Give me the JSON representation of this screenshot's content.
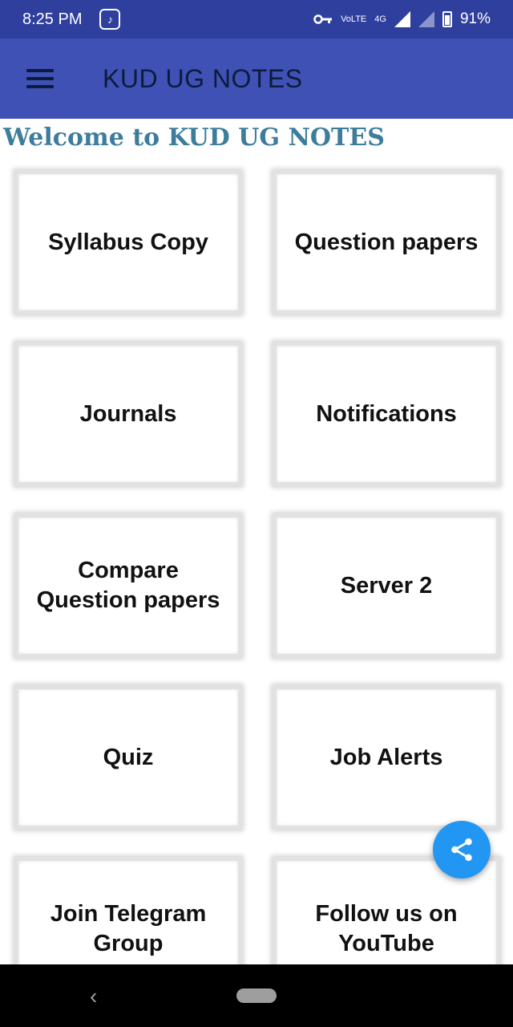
{
  "status_bar": {
    "time": "8:25 PM",
    "app_icon": "saavn-icon",
    "network": "4G",
    "volte": "VoLTE",
    "battery_level": "91%"
  },
  "app_bar": {
    "menu_icon": "hamburger-menu-icon",
    "title": "KUD UG NOTES"
  },
  "welcome": "Welcome to KUD UG NOTES",
  "cards": [
    {
      "label": "Syllabus Copy"
    },
    {
      "label": "Question papers"
    },
    {
      "label": "Journals"
    },
    {
      "label": "Notifications"
    },
    {
      "label": "Compare\nQuestion papers"
    },
    {
      "label": "Server 2"
    },
    {
      "label": "Quiz"
    },
    {
      "label": "Job Alerts"
    },
    {
      "label": "Join Telegram\nGroup"
    },
    {
      "label": "Follow us on\nYouTube"
    }
  ],
  "fab": {
    "icon": "share-icon",
    "color": "#2196f3"
  },
  "nav": {
    "back_icon": "back-chevron-icon",
    "home_icon": "home-pill-icon"
  },
  "colors": {
    "app_bar": "#3f51b5",
    "status_bar": "#2f3f9e",
    "welcome": "#3d7d9c"
  }
}
